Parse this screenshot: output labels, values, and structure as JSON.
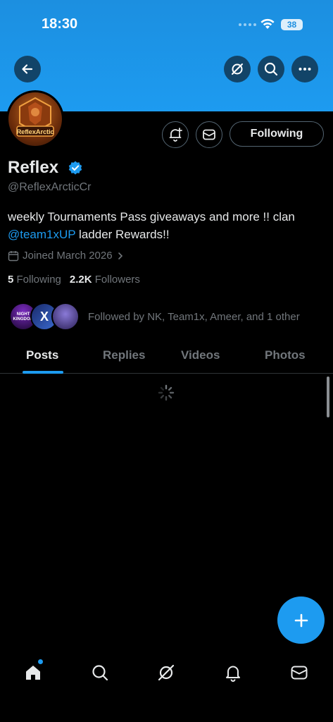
{
  "status_bar": {
    "time": "18:30",
    "battery": "38"
  },
  "header": {
    "back_icon": "back-arrow-icon",
    "grok_icon": "grok-icon",
    "search_icon": "search-icon",
    "more_icon": "more-icon"
  },
  "profile": {
    "avatar_text": "ReflexArctic",
    "name": "Reflex",
    "handle": "@ReflexArcticCr",
    "bio_before": "weekly Tournaments Pass giveaways and more !! clan ",
    "bio_mention": "@team1xUP",
    "bio_after": " ladder Rewards!!",
    "joined": "Joined March 2026",
    "following_count": "5",
    "following_label": "Following",
    "followers_count": "2.2K",
    "followers_label": "Followers",
    "followed_by": "Followed by NK, Team1x, Ameer, and 1 other",
    "followed_avatar_1_text": "NIGHT KINGDOM",
    "followed_avatar_2_text": "X"
  },
  "actions": {
    "following_button": "Following"
  },
  "tabs": [
    {
      "label": "Posts",
      "active": true
    },
    {
      "label": "Replies",
      "active": false
    },
    {
      "label": "Videos",
      "active": false
    },
    {
      "label": "Photos",
      "active": false
    }
  ],
  "bottom_nav": [
    "home-icon",
    "search-icon",
    "grok-icon",
    "notifications-icon",
    "messages-icon"
  ],
  "colors": {
    "accent": "#1d9bf0",
    "banner": "#1d9bf0",
    "background": "#000000"
  }
}
